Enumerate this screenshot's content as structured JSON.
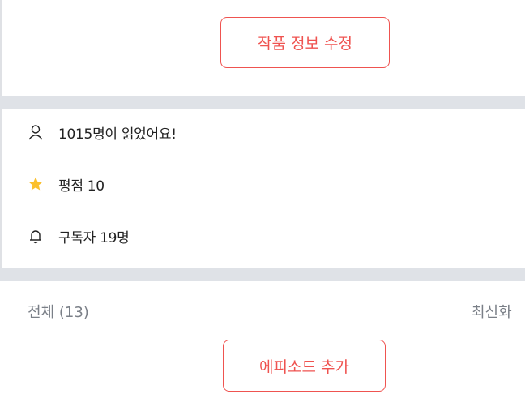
{
  "work": {
    "edit_button_label": "작품 정보 수정"
  },
  "stats": {
    "readers": "1015명이 읽었어요!",
    "rating": "평점 10",
    "subscribers": "구독자 19명"
  },
  "episodes": {
    "count_label": "전체 (13)",
    "sort_label": "최신화",
    "add_button_label": "에피소드 추가"
  },
  "colors": {
    "accent": "#ef5350",
    "divider": "#dfe2e7",
    "muted_text": "#7a7f87",
    "star": "#fbc02d"
  },
  "icons": {
    "readers": "person-icon",
    "rating": "star-icon",
    "subscribers": "bell-icon"
  }
}
